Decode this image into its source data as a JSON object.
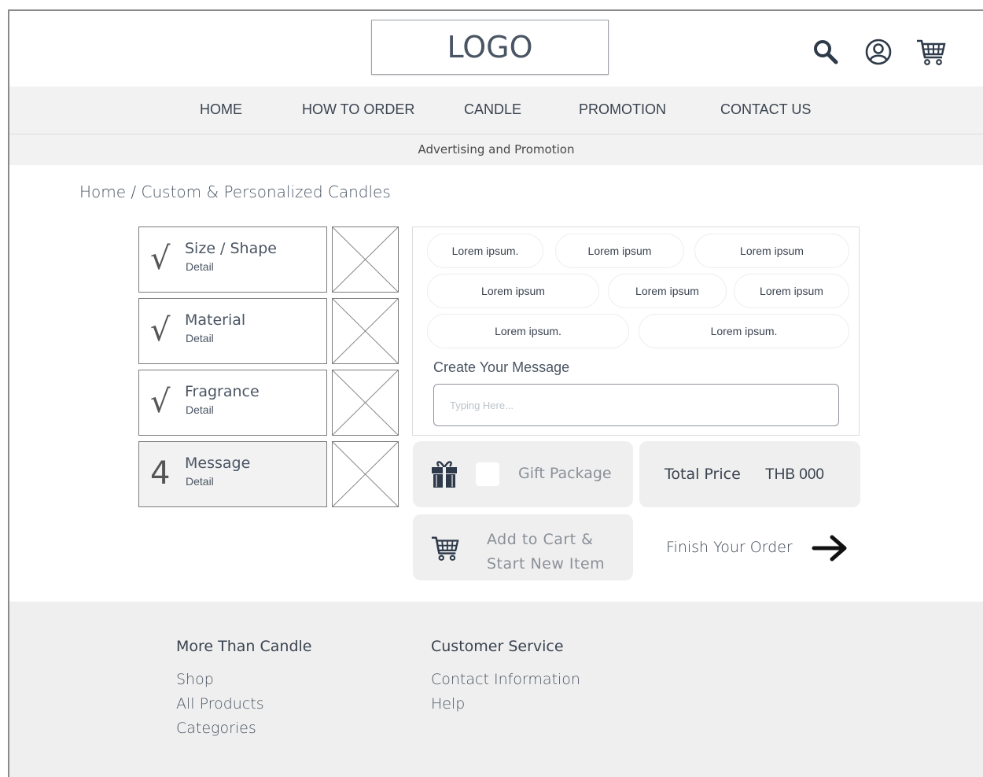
{
  "header": {
    "logo": "LOGO",
    "icons": [
      "search-icon",
      "user-icon",
      "cart-icon"
    ]
  },
  "nav": {
    "items": [
      "HOME",
      "HOW TO ORDER",
      "CANDLE",
      "PROMOTION",
      "CONTACT US"
    ]
  },
  "promo": {
    "text": "Advertising and Promotion"
  },
  "breadcrumb": {
    "text": "Home / Custom & Personalized Candles"
  },
  "steps": [
    {
      "mark": "√",
      "title": "Size / Shape",
      "detail": "Detail"
    },
    {
      "mark": "√",
      "title": "Material",
      "detail": "Detail"
    },
    {
      "mark": "√",
      "title": "Fragrance",
      "detail": "Detail"
    },
    {
      "mark": "4",
      "title": "Message",
      "detail": "Detail"
    }
  ],
  "options": {
    "chips": [
      "Lorem ipsum.",
      "Lorem ipsum",
      "Lorem ipsum",
      "Lorem ipsum",
      "Lorem ipsum",
      "Lorem ipsum",
      "Lorem ipsum.",
      "Lorem ipsum."
    ],
    "message_label": "Create Your Message",
    "message_placeholder": "Typing Here..."
  },
  "gift": {
    "label": "Gift Package"
  },
  "price": {
    "label": "Total Price",
    "value": "THB 000"
  },
  "add_to_cart": {
    "line1": "Add to Cart &",
    "line2": "Start New Item"
  },
  "finish": {
    "label": "Finish Your Order"
  },
  "footer": {
    "col1": {
      "heading": "More Than Candle",
      "links": [
        "Shop",
        "All Products",
        "Categories"
      ]
    },
    "col2": {
      "heading": "Customer Service",
      "links": [
        "Contact Information",
        "Help"
      ]
    }
  },
  "colors": {
    "text": "#3f4a57",
    "band": "#f2f2f2",
    "card": "#efefef",
    "icon": "#2e3a4a"
  }
}
